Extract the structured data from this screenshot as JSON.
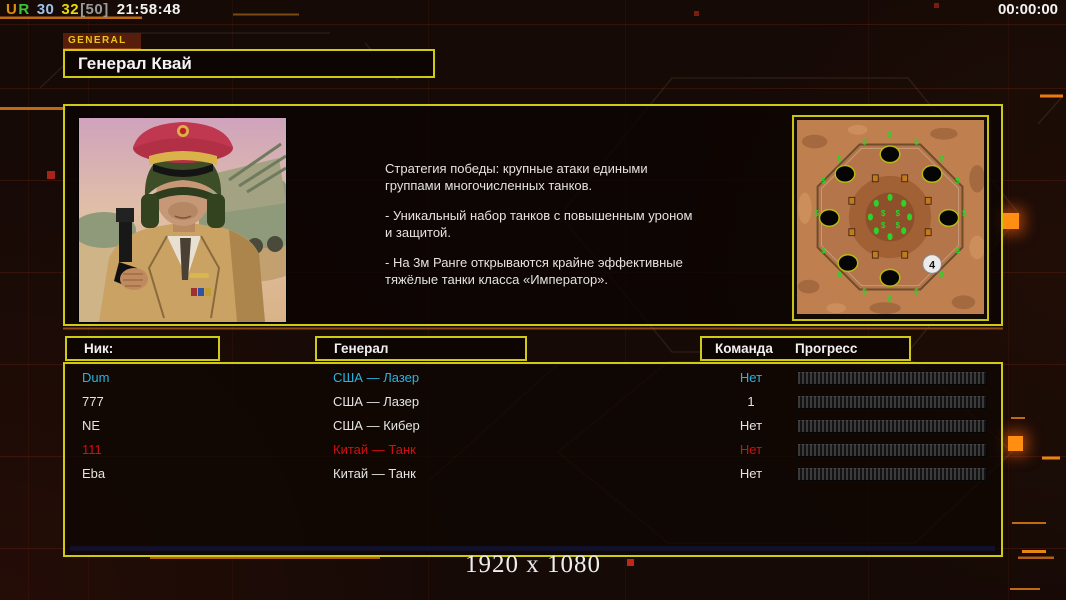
{
  "status_bar": {
    "u": "U",
    "r": "R",
    "stat_blue": "30",
    "stat_yellow": "32",
    "stat_bracket": "[50]",
    "clock": "21:58:48",
    "match_timer": "00:00:00"
  },
  "header": {
    "tab": "GENERAL",
    "title": "Генерал Квай"
  },
  "info_panel": {
    "strategy_paragraphs": [
      "Стратегия победы: крупные атаки едиными\n группами многочисленных танков.",
      "- Уникальный набор танков с повышенным уроном\n и защитой.",
      "- На 3м Ранге открываются крайне эффективные\n тяжёлые танки класса «Император»."
    ],
    "minimap": {
      "start_position_label": "4",
      "supply_symbol": "$"
    }
  },
  "players_table": {
    "headers": {
      "nick": "Ник:",
      "general": "Генерал",
      "team": "Команда",
      "progress": "Прогресс"
    },
    "rows": [
      {
        "nick": "Dum",
        "general": "США — Лазер",
        "team": "Нет",
        "color": "#27b4e4",
        "progress_percent": 0
      },
      {
        "nick": "777",
        "general": "США — Лазер",
        "team": "1",
        "color": "#e4e4e4",
        "progress_percent": 0
      },
      {
        "nick": "NE",
        "general": "США — Кибер",
        "team": "Нет",
        "color": "#e4e4e4",
        "progress_percent": 0
      },
      {
        "nick": "111",
        "general": "Китай — Танк",
        "team": "Нет",
        "color": "#d01010",
        "progress_percent": 0
      },
      {
        "nick": "Eba",
        "general": "Китай — Танк",
        "team": "Нет",
        "color": "#e4e4e4",
        "progress_percent": 0
      }
    ]
  },
  "footer": {
    "resolution": "1920 x 1080"
  },
  "colors": {
    "accent_yellow": "#d0ca12",
    "accent_orange": "#c06a14",
    "stat_orange": "#e09010",
    "stat_green": "#38c838",
    "stat_blue": "#9cc2ee",
    "stat_yellow": "#e8d80a",
    "stat_gray": "#9a9a9a",
    "player_cyan": "#27b4e4",
    "player_red": "#d01010"
  }
}
